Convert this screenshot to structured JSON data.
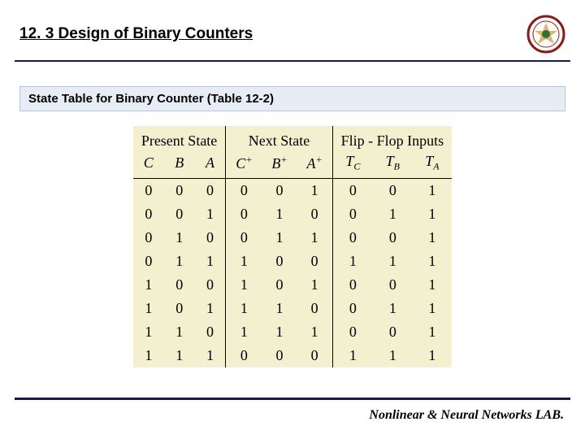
{
  "header": {
    "title": "12. 3 Design of Binary Counters",
    "logo_name": "university-seal-icon"
  },
  "subtitle": "State Table for Binary Counter (Table 12-2)",
  "table": {
    "groups": [
      "Present State",
      "Next State",
      "Flip - Flop Inputs"
    ],
    "cols_present": [
      "C",
      "B",
      "A"
    ],
    "cols_next": [
      "C⁺",
      "B⁺",
      "A⁺"
    ],
    "cols_ff": [
      "T_C",
      "T_B",
      "T_A"
    ],
    "rows": [
      [
        "0",
        "0",
        "0",
        "0",
        "0",
        "1",
        "0",
        "0",
        "1"
      ],
      [
        "0",
        "0",
        "1",
        "0",
        "1",
        "0",
        "0",
        "1",
        "1"
      ],
      [
        "0",
        "1",
        "0",
        "0",
        "1",
        "1",
        "0",
        "0",
        "1"
      ],
      [
        "0",
        "1",
        "1",
        "1",
        "0",
        "0",
        "1",
        "1",
        "1"
      ],
      [
        "1",
        "0",
        "0",
        "1",
        "0",
        "1",
        "0",
        "0",
        "1"
      ],
      [
        "1",
        "0",
        "1",
        "1",
        "1",
        "0",
        "0",
        "1",
        "1"
      ],
      [
        "1",
        "1",
        "0",
        "1",
        "1",
        "1",
        "0",
        "0",
        "1"
      ],
      [
        "1",
        "1",
        "1",
        "0",
        "0",
        "0",
        "1",
        "1",
        "1"
      ]
    ]
  },
  "footer": "Nonlinear & Neural Networks LAB.",
  "chart_data": {
    "type": "table",
    "title": "State Table for Binary Counter (Table 12-2)",
    "column_groups": [
      {
        "name": "Present State",
        "columns": [
          "C",
          "B",
          "A"
        ]
      },
      {
        "name": "Next State",
        "columns": [
          "C+",
          "B+",
          "A+"
        ]
      },
      {
        "name": "Flip-Flop Inputs",
        "columns": [
          "TC",
          "TB",
          "TA"
        ]
      }
    ],
    "rows": [
      {
        "C": 0,
        "B": 0,
        "A": 0,
        "C+": 0,
        "B+": 0,
        "A+": 1,
        "TC": 0,
        "TB": 0,
        "TA": 1
      },
      {
        "C": 0,
        "B": 0,
        "A": 1,
        "C+": 0,
        "B+": 1,
        "A+": 0,
        "TC": 0,
        "TB": 1,
        "TA": 1
      },
      {
        "C": 0,
        "B": 1,
        "A": 0,
        "C+": 0,
        "B+": 1,
        "A+": 1,
        "TC": 0,
        "TB": 0,
        "TA": 1
      },
      {
        "C": 0,
        "B": 1,
        "A": 1,
        "C+": 1,
        "B+": 0,
        "A+": 0,
        "TC": 1,
        "TB": 1,
        "TA": 1
      },
      {
        "C": 1,
        "B": 0,
        "A": 0,
        "C+": 1,
        "B+": 0,
        "A+": 1,
        "TC": 0,
        "TB": 0,
        "TA": 1
      },
      {
        "C": 1,
        "B": 0,
        "A": 1,
        "C+": 1,
        "B+": 1,
        "A+": 0,
        "TC": 0,
        "TB": 1,
        "TA": 1
      },
      {
        "C": 1,
        "B": 1,
        "A": 0,
        "C+": 1,
        "B+": 1,
        "A+": 1,
        "TC": 0,
        "TB": 0,
        "TA": 1
      },
      {
        "C": 1,
        "B": 1,
        "A": 1,
        "C+": 0,
        "B+": 0,
        "A+": 0,
        "TC": 1,
        "TB": 1,
        "TA": 1
      }
    ]
  }
}
